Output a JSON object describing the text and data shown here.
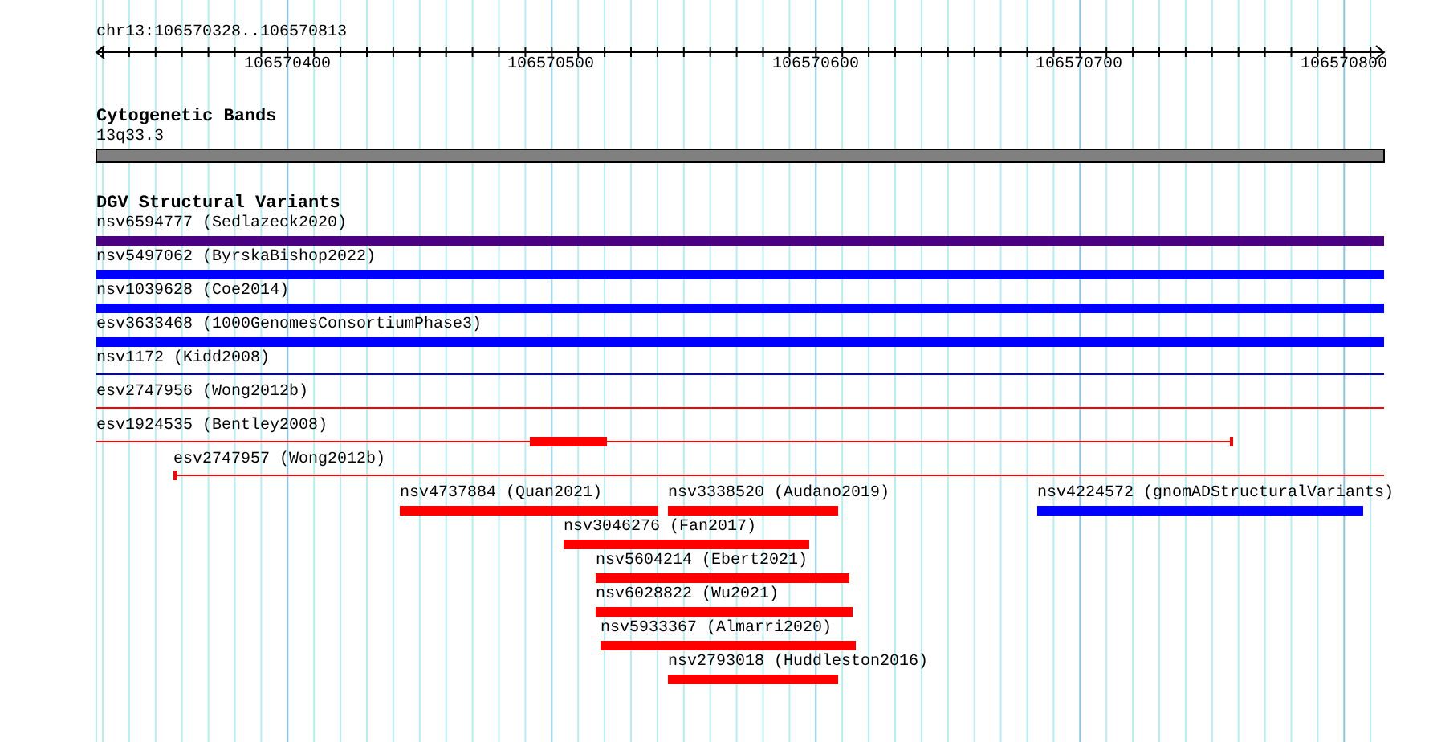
{
  "ruler": {
    "range": "chr13:106570328..106570813",
    "ticks": [
      "106570400",
      "106570500",
      "106570600",
      "106570700",
      "106570800"
    ]
  },
  "cytogenetic_track": {
    "title": "Cytogenetic Bands",
    "band": "13q33.3"
  },
  "variant_track": {
    "title": "DGV Structural Variants",
    "variants": [
      {
        "label": "nsv6594777 (Sedlazeck2020)",
        "kind": "bar",
        "color": "#4b0082"
      },
      {
        "label": "nsv5497062 (ByrskaBishop2022)",
        "kind": "bar",
        "color": "#0000ff"
      },
      {
        "label": "nsv1039628 (Coe2014)",
        "kind": "bar",
        "color": "#0000ff"
      },
      {
        "label": "esv3633468 (1000GenomesConsortiumPhase3)",
        "kind": "bar",
        "color": "#0000ff"
      },
      {
        "label": "nsv1172 (Kidd2008)",
        "kind": "line",
        "color": "#0000cc"
      },
      {
        "label": "esv2747956 (Wong2012b)",
        "kind": "line",
        "color": "#ff0000"
      },
      {
        "label": "esv1924535 (Bentley2008)",
        "kind": "gapped",
        "color": "#ff0000"
      },
      {
        "label": "esv2747957 (Wong2012b)",
        "kind": "line",
        "color": "#ff0000"
      },
      {
        "label": "nsv4737884 (Quan2021)",
        "kind": "bar",
        "color": "#ff0000"
      },
      {
        "label": "nsv3338520 (Audano2019)",
        "kind": "bar",
        "color": "#ff0000"
      },
      {
        "label": "nsv4224572 (gnomADStructuralVariants)",
        "kind": "bar",
        "color": "#0000ff"
      },
      {
        "label": "nsv3046276 (Fan2017)",
        "kind": "bar",
        "color": "#ff0000"
      },
      {
        "label": "nsv5604214 (Ebert2021)",
        "kind": "bar",
        "color": "#ff0000"
      },
      {
        "label": "nsv6028822 (Wu2021)",
        "kind": "bar",
        "color": "#ff0000"
      },
      {
        "label": "nsv5933367 (Almarri2020)",
        "kind": "bar",
        "color": "#ff0000"
      },
      {
        "label": "nsv2793018 (Huddleston2016)",
        "kind": "bar",
        "color": "#ff0000"
      }
    ]
  }
}
